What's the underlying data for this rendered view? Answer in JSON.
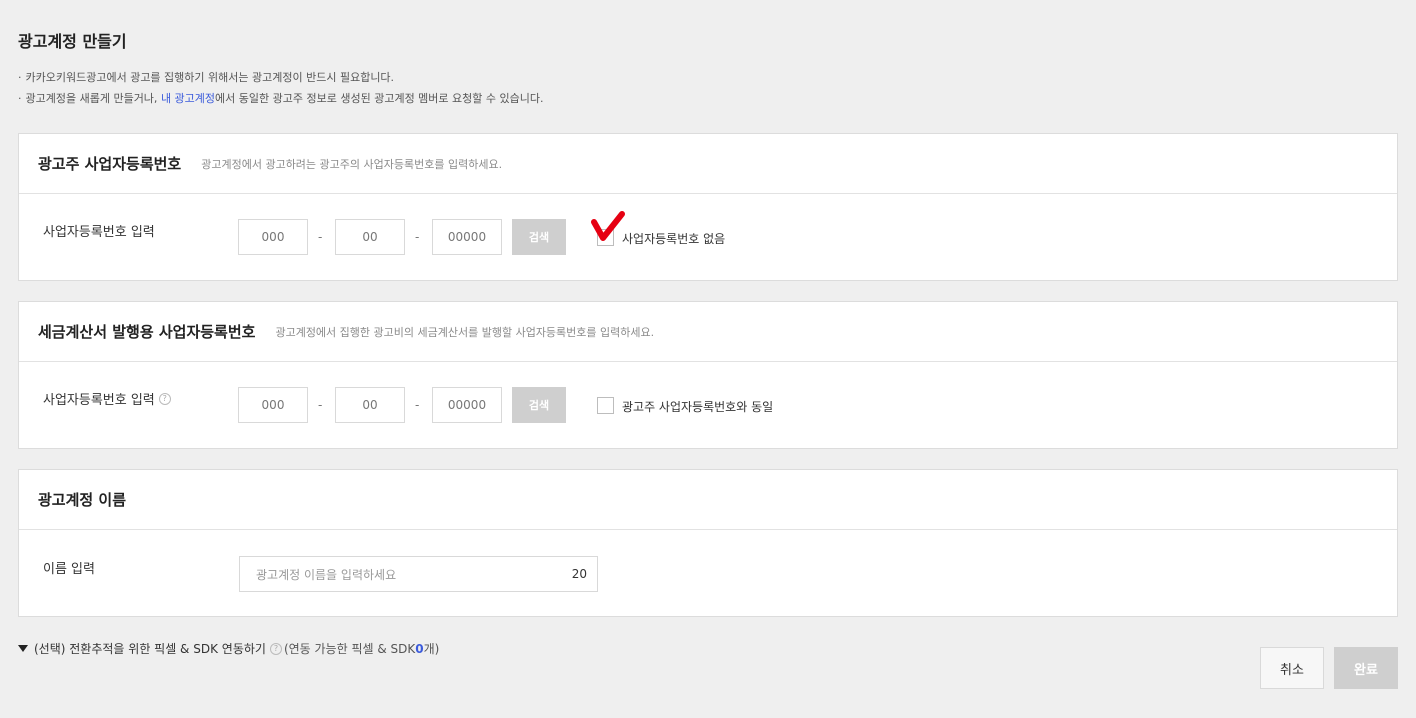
{
  "page": {
    "title": "광고계정 만들기",
    "notice_1": "카카오키워드광고에서 광고를 집행하기 위해서는 광고계정이 반드시 필요합니다.",
    "notice_2_pre": "광고계정을 새롭게 만들거나, ",
    "notice_2_link": "내 광고계정",
    "notice_2_post": "에서 동일한 광고주 정보로 생성된 광고계정 멤버로 요청할 수 있습니다.",
    "bullet": "·"
  },
  "advertiser_section": {
    "title": "광고주 사업자등록번호",
    "description": "광고계정에서 광고하려는 광고주의 사업자등록번호를 입력하세요.",
    "row_label": "사업자등록번호 입력",
    "field_1": "000",
    "field_2": "00",
    "field_3": "00000",
    "separator": "-",
    "search_label": "검색",
    "checkbox_label": "사업자등록번호 없음"
  },
  "tax_section": {
    "title": "세금계산서 발행용 사업자등록번호",
    "description": "광고계정에서 집행한 광고비의 세금계산서를 발행할 사업자등록번호를 입력하세요.",
    "row_label": "사업자등록번호 입력",
    "help": "?",
    "field_1": "000",
    "field_2": "00",
    "field_3": "00000",
    "separator": "-",
    "search_label": "검색",
    "checkbox_label": "광고주 사업자등록번호와 동일"
  },
  "name_section": {
    "title": "광고계정 이름",
    "row_label": "이름 입력",
    "placeholder": "광고계정 이름을 입력하세요",
    "char_count": "20"
  },
  "pixel_toggle": {
    "label": "(선택) 전환추적을 위한 픽셀 & SDK 연동하기",
    "help": "?",
    "sub_pre": "(연동 가능한 픽셀 & SDK ",
    "count": "0",
    "sub_post": "개)"
  },
  "footer": {
    "cancel_label": "취소",
    "done_label": "완료"
  },
  "colors": {
    "link": "#3b5bdb",
    "annotation_mark": "#e60012",
    "disabled_button": "#cfcfcf"
  }
}
